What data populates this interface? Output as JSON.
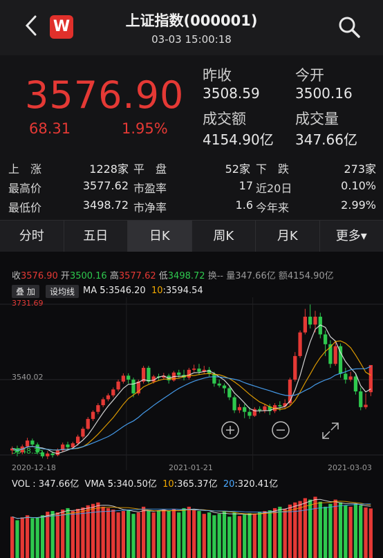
{
  "header": {
    "title": "上证指数(000001)",
    "subtitle": "03-03 15:00:18",
    "logo_text": "W"
  },
  "quote": {
    "price": "3576.90",
    "change": "68.31",
    "change_pct": "1.95%",
    "prev_close_label": "昨收",
    "prev_close": "3508.59",
    "open_label": "今开",
    "open": "3500.16",
    "turnover_label": "成交额",
    "turnover": "4154.90亿",
    "volume_label": "成交量",
    "volume": "347.66亿"
  },
  "stats": {
    "up_label": "上　涨",
    "up_value": "1228家",
    "flat_label": "平　盘",
    "flat_value": "52家",
    "down_label": "下　跌",
    "down_value": "273家",
    "high_label": "最高价",
    "high_value": "3577.62",
    "pe_label": "市盈率",
    "pe_value": "17",
    "d20_label": "近20日",
    "d20_value": "0.10%",
    "low_label": "最低价",
    "low_value": "3498.72",
    "pb_label": "市净率",
    "pb_value": "1.6",
    "ytd_label": "今年来",
    "ytd_value": "2.99%"
  },
  "tabs": [
    {
      "label": "分时"
    },
    {
      "label": "五日"
    },
    {
      "label": "日K"
    },
    {
      "label": "周K"
    },
    {
      "label": "月K"
    },
    {
      "label": "更多▾"
    }
  ],
  "kline_info": {
    "close_label": "收",
    "close": "3576.90",
    "open_label": "开",
    "open": "3500.16",
    "high_label": "高",
    "high": "3577.62",
    "low_label": "低",
    "low": "3498.72",
    "turnover_rate": "换--",
    "vol_label": "量",
    "vol": "347.66亿",
    "amount_label": "额",
    "amount": "4154.90亿"
  },
  "ma_bar": {
    "overlay_btn": "叠 加",
    "setting_btn": "设均线",
    "ma_label": "MA",
    "ma5_label": "5",
    "ma5_value": "3546.20",
    "ma10_label": "10",
    "ma10_value": "3594.54"
  },
  "vol_bar": {
    "vol_text": "VOL : 347.66亿",
    "vma_label": "VMA",
    "vma5_label": "5",
    "vma5_value": "340.50亿",
    "vma10_label": "10",
    "vma10_value": "365.37亿",
    "vma20_label": "20",
    "vma20_value": "320.41亿"
  },
  "chart_data": {
    "type": "candlestick",
    "y_axis_labels": [
      "3731.69",
      "3540.02",
      "3348.35"
    ],
    "ylim": [
      3348.35,
      3731.69
    ],
    "x_axis_labels": [
      "2020-12-18",
      "2021-01-21",
      "2021-03-03"
    ],
    "colors": {
      "up": "#e53935",
      "down": "#2ec84e",
      "ma5": "#e8e8e8",
      "ma10": "#f2a900",
      "ma20": "#4aa8ff"
    },
    "candles": [
      [
        3360,
        3365,
        3350,
        3370
      ],
      [
        3365,
        3355,
        3345,
        3372
      ],
      [
        3355,
        3370,
        3350,
        3375
      ],
      [
        3370,
        3385,
        3365,
        3392
      ],
      [
        3385,
        3375,
        3370,
        3390
      ],
      [
        3375,
        3355,
        3350,
        3380
      ],
      [
        3355,
        3345,
        3340,
        3360
      ],
      [
        3345,
        3352,
        3338,
        3358
      ],
      [
        3352,
        3348,
        3342,
        3357
      ],
      [
        3348,
        3360,
        3345,
        3365
      ],
      [
        3360,
        3375,
        3356,
        3380
      ],
      [
        3375,
        3368,
        3362,
        3382
      ],
      [
        3368,
        3378,
        3365,
        3382
      ],
      [
        3378,
        3395,
        3372,
        3400
      ],
      [
        3395,
        3415,
        3390,
        3420
      ],
      [
        3415,
        3440,
        3412,
        3445
      ],
      [
        3440,
        3458,
        3435,
        3462
      ],
      [
        3458,
        3475,
        3452,
        3480
      ],
      [
        3475,
        3490,
        3470,
        3495
      ],
      [
        3490,
        3500,
        3485,
        3505
      ],
      [
        3500,
        3515,
        3495,
        3520
      ],
      [
        3515,
        3535,
        3510,
        3540
      ],
      [
        3535,
        3550,
        3530,
        3556
      ],
      [
        3550,
        3540,
        3530,
        3556
      ],
      [
        3540,
        3505,
        3495,
        3545
      ],
      [
        3505,
        3535,
        3500,
        3540
      ],
      [
        3535,
        3570,
        3530,
        3575
      ],
      [
        3570,
        3535,
        3530,
        3575
      ],
      [
        3535,
        3548,
        3530,
        3552
      ],
      [
        3548,
        3545,
        3538,
        3555
      ],
      [
        3545,
        3550,
        3540,
        3557
      ],
      [
        3550,
        3538,
        3530,
        3555
      ],
      [
        3538,
        3558,
        3535,
        3562
      ],
      [
        3558,
        3552,
        3545,
        3565
      ],
      [
        3552,
        3545,
        3538,
        3565
      ],
      [
        3545,
        3565,
        3540,
        3570
      ],
      [
        3565,
        3568,
        3560,
        3578
      ],
      [
        3568,
        3560,
        3552,
        3580
      ],
      [
        3560,
        3565,
        3555,
        3575
      ],
      [
        3565,
        3555,
        3548,
        3572
      ],
      [
        3555,
        3530,
        3522,
        3560
      ],
      [
        3530,
        3525,
        3520,
        3540
      ],
      [
        3525,
        3518,
        3505,
        3530
      ],
      [
        3518,
        3495,
        3488,
        3522
      ],
      [
        3495,
        3462,
        3455,
        3500
      ],
      [
        3462,
        3470,
        3455,
        3478
      ],
      [
        3470,
        3458,
        3442,
        3478
      ],
      [
        3458,
        3448,
        3440,
        3470
      ],
      [
        3448,
        3465,
        3445,
        3470
      ],
      [
        3465,
        3462,
        3455,
        3472
      ],
      [
        3462,
        3472,
        3455,
        3478
      ],
      [
        3472,
        3460,
        3450,
        3478
      ],
      [
        3460,
        3475,
        3455,
        3480
      ],
      [
        3475,
        3472,
        3460,
        3485
      ],
      [
        3472,
        3480,
        3465,
        3490
      ],
      [
        3480,
        3540,
        3475,
        3545
      ],
      [
        3540,
        3600,
        3535,
        3610
      ],
      [
        3600,
        3660,
        3595,
        3665
      ],
      [
        3660,
        3700,
        3655,
        3720
      ],
      [
        3700,
        3680,
        3670,
        3731
      ],
      [
        3680,
        3700,
        3660,
        3715
      ],
      [
        3700,
        3655,
        3645,
        3710
      ],
      [
        3655,
        3630,
        3600,
        3665
      ],
      [
        3630,
        3580,
        3570,
        3640
      ],
      [
        3580,
        3625,
        3575,
        3635
      ],
      [
        3625,
        3555,
        3545,
        3632
      ],
      [
        3555,
        3540,
        3530,
        3570
      ],
      [
        3540,
        3548,
        3535,
        3560
      ],
      [
        3548,
        3510,
        3502,
        3556
      ],
      [
        3510,
        3470,
        3462,
        3520
      ],
      [
        3470,
        3476,
        3465,
        3505
      ],
      [
        3508,
        3577,
        3498,
        3577
      ]
    ],
    "volumes": [
      290,
      265,
      285,
      300,
      280,
      285,
      300,
      325,
      330,
      320,
      340,
      350,
      330,
      345,
      355,
      370,
      380,
      390,
      360,
      350,
      340,
      320,
      330,
      340,
      310,
      320,
      360,
      330,
      320,
      335,
      340,
      330,
      345,
      320,
      350,
      360,
      340,
      330,
      310,
      320,
      300,
      310,
      330,
      290,
      320,
      295,
      305,
      315,
      310,
      325,
      330,
      335,
      350,
      360,
      345,
      375,
      390,
      400,
      420,
      410,
      430,
      395,
      360,
      380,
      410,
      390,
      370,
      360,
      380,
      370,
      355,
      347.66
    ]
  }
}
